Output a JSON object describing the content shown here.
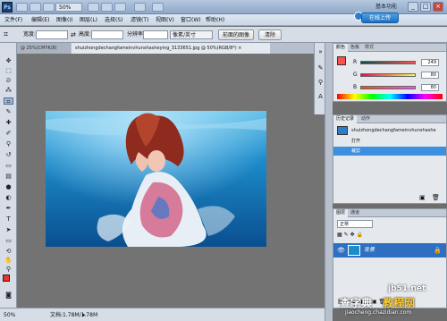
{
  "app": {
    "logo": "Ps",
    "zoom": "50%",
    "workspace": "基本功能",
    "update_button": "在线上传"
  },
  "menu": [
    "文件(F)",
    "编辑(E)",
    "图像(I)",
    "图层(L)",
    "选择(S)",
    "滤镜(T)",
    "视图(V)",
    "窗口(W)",
    "帮助(H)"
  ],
  "options": {
    "width_label": "宽度:",
    "height_label": "高度:",
    "resolution_label": "分辨率:",
    "unit": "像素/英寸",
    "front_image": "前面的图像",
    "clear": "清除"
  },
  "tabs": [
    {
      "label": "@ 25%(CMYK/8)"
    },
    {
      "label": "shuizhongdechangfameinvhunshasheying_3133651.jpg @ 50%(RGB/8*) ×"
    }
  ],
  "status": {
    "zoom": "50%",
    "doc_info": "文档:1.78M/1.78M"
  },
  "color_panel": {
    "tabs": [
      "颜色",
      "色板",
      "样式"
    ],
    "channels": [
      {
        "label": "R",
        "value": "249"
      },
      {
        "label": "G",
        "value": "80"
      },
      {
        "label": "B",
        "value": "80"
      }
    ],
    "foreground": "#f95050"
  },
  "history_panel": {
    "tabs": [
      "历史记录",
      "动作"
    ],
    "snapshot": "shuizhongdechangfameinvhunshashe",
    "items": [
      "打开",
      "裁剪"
    ]
  },
  "layers_panel": {
    "tabs": [
      "图层",
      "通道"
    ],
    "blend_mode": "正常",
    "layer_name": "背景"
  },
  "watermark": {
    "site": "jb51.net",
    "name": "查字典",
    "sub": "教程网",
    "url": "jiaocheng.chazidian.com"
  }
}
